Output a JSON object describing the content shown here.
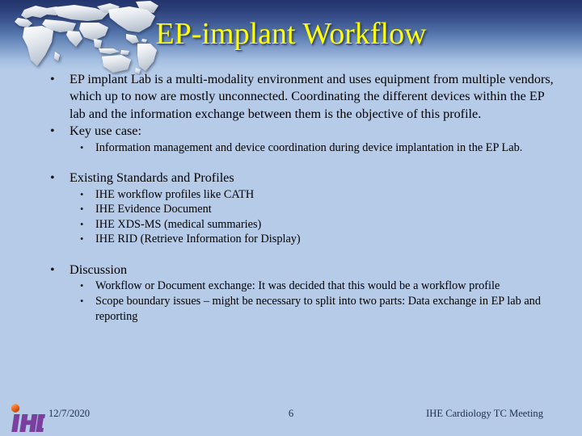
{
  "slide": {
    "title": "EP-implant Workflow",
    "title_color": "#ffff00",
    "background_color": "#b6cbe8",
    "header_gradient_top": "#23346c",
    "header_gradient_bottom": "#b6cbe8",
    "bullet_glyph": "•"
  },
  "content": {
    "blocks": [
      {
        "level": 1,
        "text": "EP implant Lab is a multi-modality environment and uses equipment from multiple vendors, which up to now are mostly unconnected. Coordinating the different devices within the EP lab and the information exchange between them is the objective of this profile."
      },
      {
        "level": 1,
        "text": "Key use case:"
      },
      {
        "level": 2,
        "text": "Information management and device coordination during device implantation in the EP Lab."
      },
      {
        "level": 1,
        "text": "Existing Standards and Profiles"
      },
      {
        "level": 2,
        "text": "IHE workflow profiles like CATH"
      },
      {
        "level": 2,
        "text": "IHE Evidence Document"
      },
      {
        "level": 2,
        "text": "IHE XDS-MS (medical summaries)"
      },
      {
        "level": 2,
        "text": "IHE RID (Retrieve Information for Display)"
      },
      {
        "level": 1,
        "text": "Discussion"
      },
      {
        "level": 2,
        "text": "Workflow or Document exchange: It was decided that this would be a workflow profile"
      },
      {
        "level": 2,
        "text": "Scope boundary issues – might be necessary to split into two parts: Data exchange in EP lab and reporting"
      }
    ]
  },
  "footer": {
    "date": "12/7/2020",
    "page_number": "6",
    "meeting": "IHE Cardiology TC Meeting",
    "logo_text": "IHE",
    "logo_color": "#7b3fa0",
    "logo_dot_color": "#e8601c",
    "text_color": "#22304d"
  }
}
